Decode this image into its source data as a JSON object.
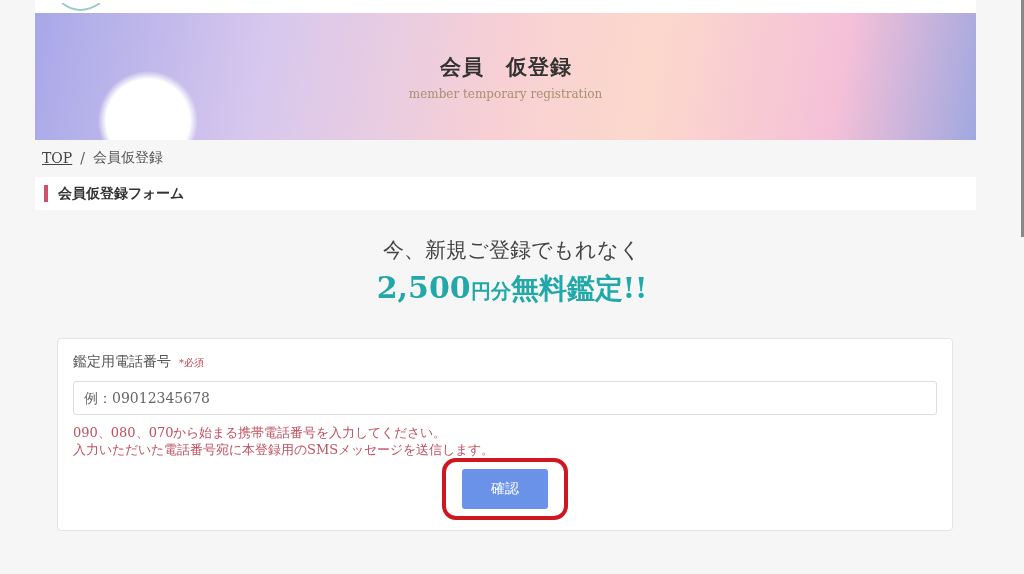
{
  "banner": {
    "title": "会員　仮登録",
    "subtitle": "member temporary registration"
  },
  "breadcrumb": [
    {
      "label": "TOP",
      "kind": "link"
    },
    {
      "label": "会員仮登録",
      "kind": "current"
    }
  ],
  "breadcrumb_separator": "/",
  "section_heading": "会員仮登録フォーム",
  "promo": {
    "line_1": "今、新規ご登録でもれなく",
    "amount": "2,500",
    "unit": "円分",
    "offer": "無料鑑定!!"
  },
  "form": {
    "label": "鑑定用電話番号",
    "required": "*必須",
    "placeholder": "例：09012345678",
    "notes": [
      "090、080、070から始まる携帯電話番号を入力してください。",
      "入力いただいた電話番号宛に本登録用のSMSメッセージを送信します。"
    ],
    "button": "確認",
    "button_highlighted": true
  }
}
